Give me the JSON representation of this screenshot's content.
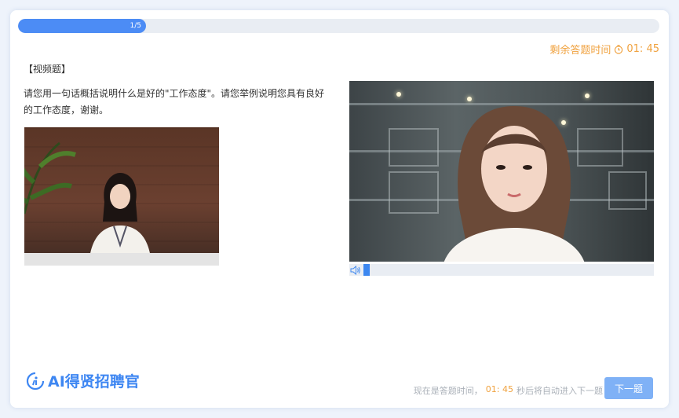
{
  "progress": {
    "label": "1/5",
    "fraction": 0.2
  },
  "timer": {
    "prefix": "剩余答题时间",
    "value": "01: 45"
  },
  "question": {
    "type_label": "【视频题】",
    "text": "请您用一句话概括说明什么是好的\"工作态度\"。请您举例说明您具有良好的工作态度，谢谢。"
  },
  "footer": {
    "note_prefix": "现在是答题时间，",
    "note_time": "01: 45",
    "note_suffix": "秒后将自动进入下一题",
    "next_label": "下一题"
  },
  "brand": {
    "name": "AI得贤招聘官"
  },
  "audio": {
    "level": 0.02
  },
  "colors": {
    "accent": "#4c8cf5",
    "warning": "#f0a23f",
    "button": "#7fb1f6"
  },
  "icons": {
    "timer": "clock-icon",
    "audio": "speaker-icon",
    "logo": "brand-logo-icon"
  }
}
